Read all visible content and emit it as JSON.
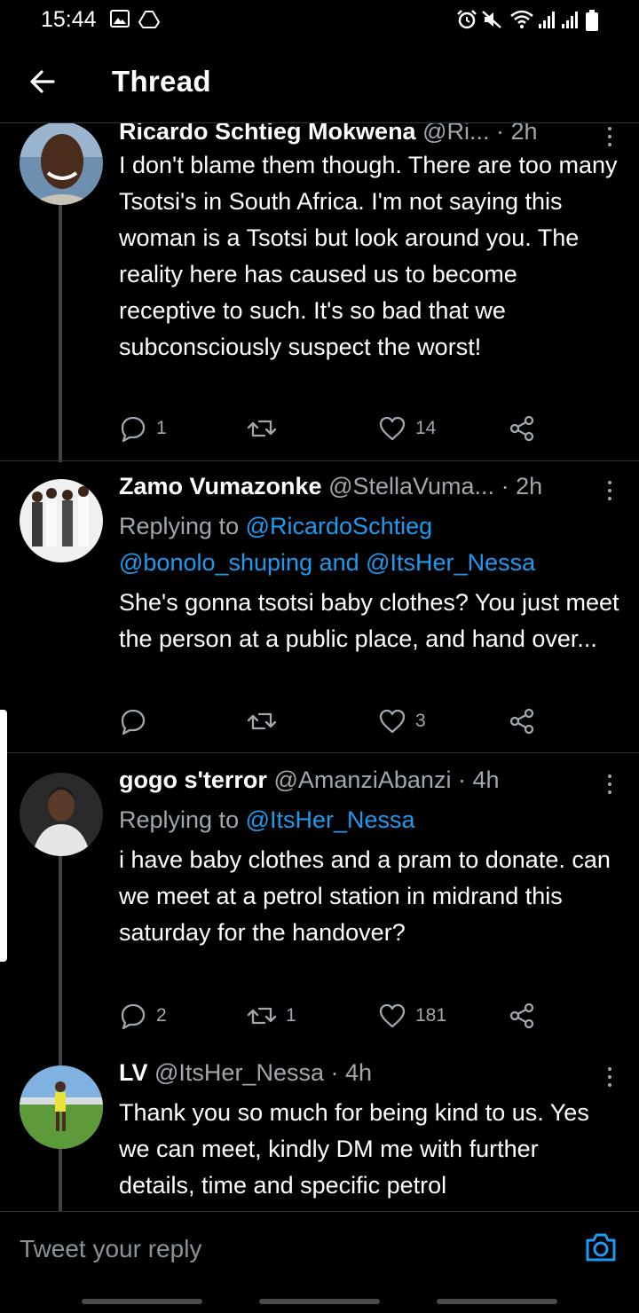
{
  "status": {
    "time": "15:44"
  },
  "header": {
    "title": "Thread"
  },
  "tweets": [
    {
      "name": "Ricardo Schtieg Mokwena",
      "handle": "@Ri...",
      "time": "2h",
      "body": "I don't blame them though. There are too many Tsotsi's in South Africa. I'm not saying this woman is a Tsotsi but look around you. The reality here has caused us to become receptive to such. It's so bad that we subconsciously suspect the worst!",
      "replies": "1",
      "retweets": "",
      "likes": "14"
    },
    {
      "name": "Zamo Vumazonke",
      "handle": "@StellaVuma...",
      "time": "2h",
      "replying_prefix": "Replying to",
      "mention_1": "@RicardoSchtieg",
      "mention_2": "@bonolo_shuping and @ItsHer_Nessa",
      "body": "She's gonna tsotsi baby clothes? You just meet the person at a public place, and hand over...",
      "replies": "",
      "retweets": "",
      "likes": "3"
    },
    {
      "name": "gogo s'terror",
      "handle": "@AmanziAbanzi",
      "time": "4h",
      "replying_prefix": "Replying to",
      "mention_1": "@ItsHer_Nessa",
      "body": "i have baby clothes and a pram to donate. can we meet at a petrol station in midrand this saturday for the handover?",
      "replies": "2",
      "retweets": "1",
      "likes": "181"
    },
    {
      "name": "LV",
      "handle": "@ItsHer_Nessa",
      "time": "4h",
      "body": "Thank you so much for being kind to us. Yes we can meet, kindly DM me with further details, time and specific petrol"
    }
  ],
  "composer": {
    "placeholder": "Tweet your reply"
  },
  "colors": {
    "background": "#000000",
    "link": "#1d9bf0",
    "secondary_text": "#a0a7ae",
    "divider": "#2f3336"
  }
}
